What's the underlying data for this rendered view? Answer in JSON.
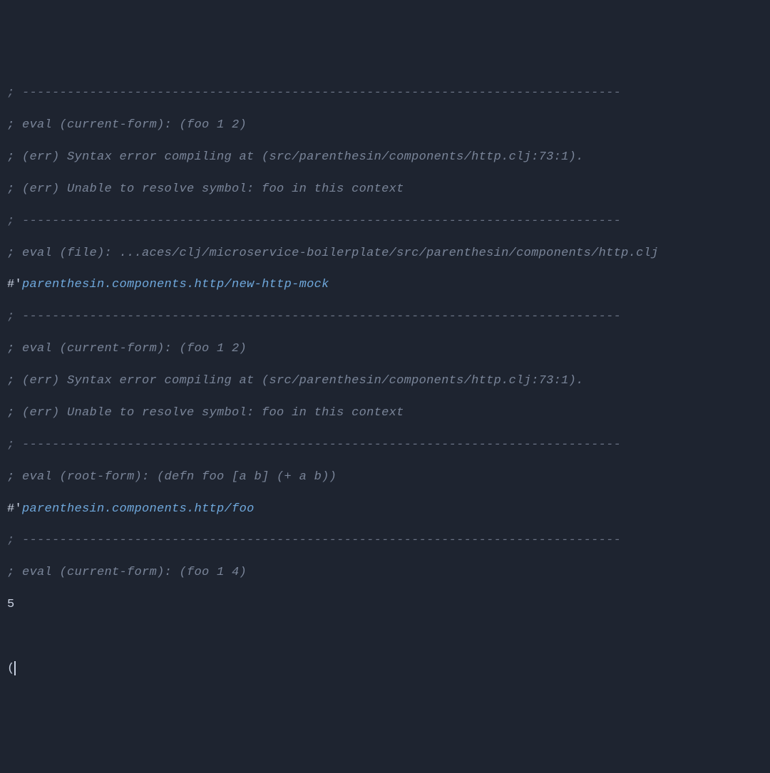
{
  "repl": {
    "sep_top": "; --------------------------------------------------------------------------------",
    "eval1_head": "; eval (current-form): (foo 1 2)",
    "eval1_err1": "; (err) Syntax error compiling at (src/parenthesin/components/http.clj:73:1).",
    "eval1_err2": "; (err) Unable to resolve symbol: foo in this context",
    "sep2": "; --------------------------------------------------------------------------------",
    "eval2_head": "; eval (file): ...aces/clj/microservice-boilerplate/src/parenthesin/components/http.clj",
    "eval2_hash": "#'",
    "eval2_sym": "parenthesin.components.http/new-http-mock",
    "sep3": "; --------------------------------------------------------------------------------",
    "eval3_head": "; eval (current-form): (foo 1 2)",
    "eval3_err1": "; (err) Syntax error compiling at (src/parenthesin/components/http.clj:73:1).",
    "eval3_err2": "; (err) Unable to resolve symbol: foo in this context",
    "sep4": "; --------------------------------------------------------------------------------",
    "eval4_head": "; eval (root-form): (defn foo [a b] (+ a b))",
    "eval4_hash": "#'",
    "eval4_sym": "parenthesin.components.http/foo",
    "sep5": "; --------------------------------------------------------------------------------",
    "eval5_head": "; eval (current-form): (foo 1 4)",
    "eval5_result": "5",
    "prompt": "("
  }
}
